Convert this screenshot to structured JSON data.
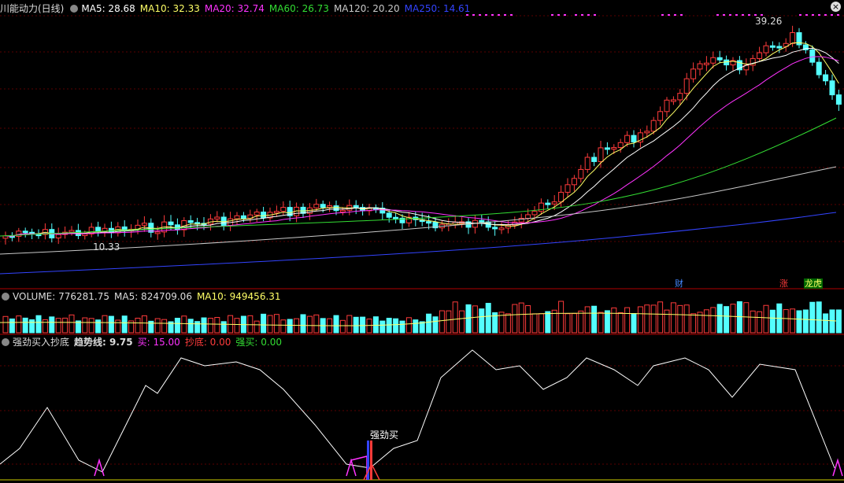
{
  "main_panel": {
    "title": "川能动力(日线)",
    "ma5": "MA5: 28.68",
    "ma10": "MA10: 32.33",
    "ma20": "MA20: 32.74",
    "ma60": "MA60: 26.73",
    "ma120": "MA120: 20.20",
    "ma250": "MA250: 14.61",
    "high_label": "39.26",
    "low_label": "10.33",
    "badges": {
      "cai": "财",
      "zhang": "涨",
      "longhu": "龙虎"
    }
  },
  "volume_panel": {
    "volume": "VOLUME: 776281.75",
    "ma5": "MA5: 824709.06",
    "ma10": "MA10: 949456.31"
  },
  "indicator_panel": {
    "name": "强劲买入抄底",
    "trend": "趋势线: 9.75",
    "buy": "买: 15.00",
    "bottom": "抄底: 0.00",
    "strong": "强买: 0.00",
    "signal_label": "强劲买"
  },
  "colors": {
    "up": "#ff3b3b",
    "down": "#54ffff",
    "ma5": "#ffffff",
    "ma10": "#ffff66",
    "ma20": "#ff33ff",
    "ma60": "#33dd33",
    "ma120": "#c8c8c8",
    "ma250": "#3344ff",
    "divider": "#b00000"
  }
}
